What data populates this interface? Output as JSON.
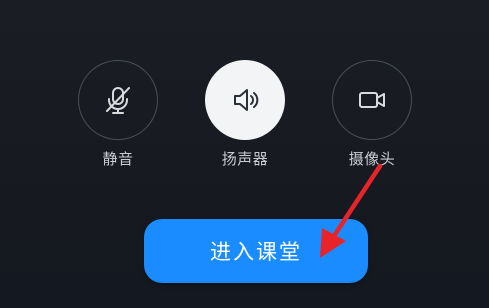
{
  "controls": {
    "mute": {
      "label": "静音",
      "icon": "microphone-off-icon",
      "active": false
    },
    "speaker": {
      "label": "扬声器",
      "icon": "speaker-icon",
      "active": true
    },
    "camera": {
      "label": "摄像头",
      "icon": "video-camera-icon",
      "active": false
    }
  },
  "enter_button": {
    "label": "进入课堂"
  },
  "colors": {
    "background": "#16191e",
    "primary": "#1a8cff",
    "annotation_arrow": "#e8242b",
    "active_circle": "#f3f4f6",
    "label_text": "#c9ccd1"
  }
}
